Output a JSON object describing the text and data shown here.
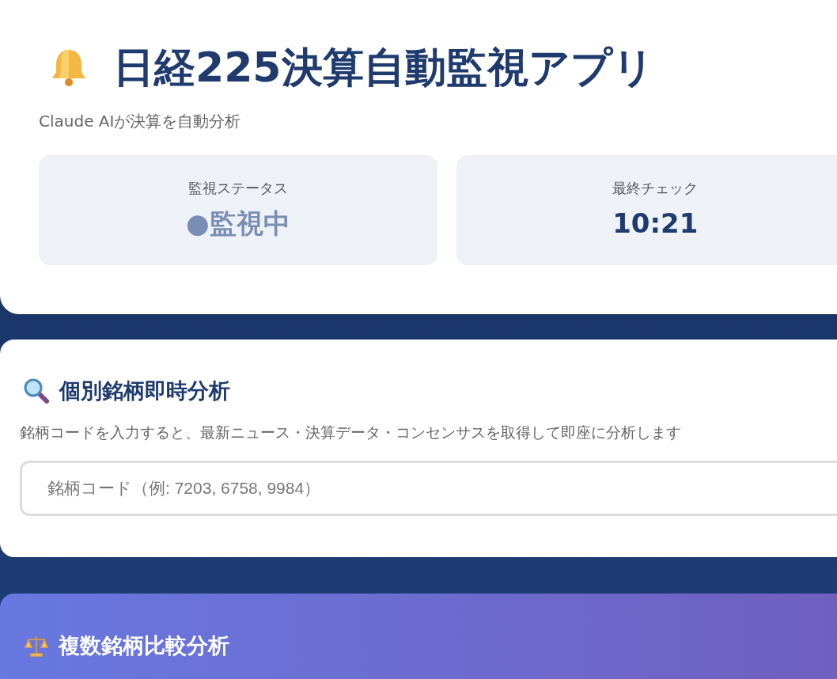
{
  "header": {
    "title": "日経225決算自動監視アプリ",
    "subtitle": "Claude AIが決算を自動分析",
    "stats": [
      {
        "label": "監視ステータス",
        "value": "●監視中",
        "kind": "status"
      },
      {
        "label": "最終チェック",
        "value": "10:21",
        "kind": "time"
      }
    ]
  },
  "single_analysis": {
    "title": "個別銘柄即時分析",
    "description": "銘柄コードを入力すると、最新ニュース・決算データ・コンセンサスを取得して即座に分析します",
    "input": {
      "placeholder": "銘柄コード（例: 7203, 6758, 9984）"
    }
  },
  "comparison": {
    "title": "複数銘柄比較分析"
  }
}
